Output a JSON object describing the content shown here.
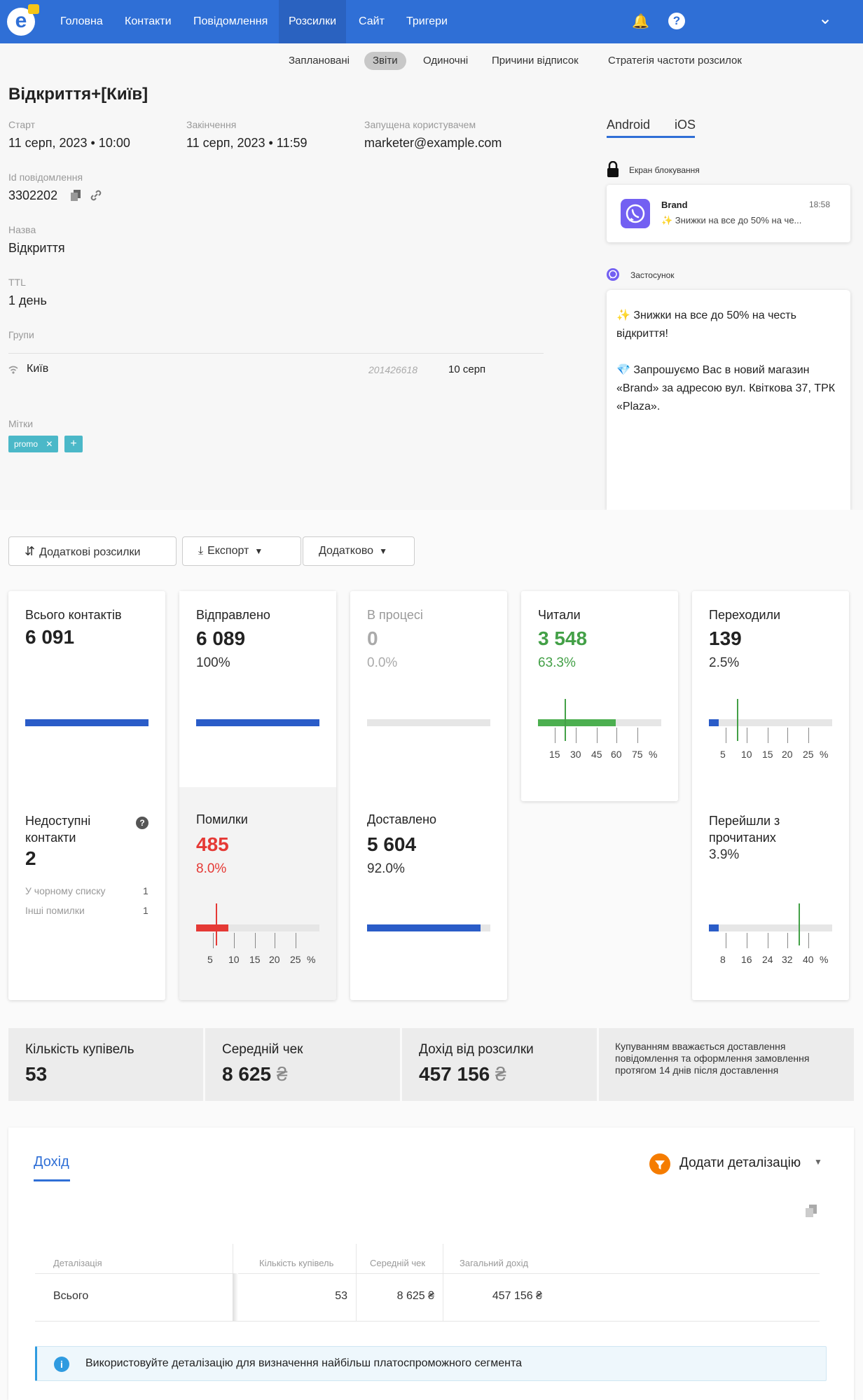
{
  "nav": {
    "logo": "e",
    "items": [
      "Головна",
      "Контакти",
      "Повідомлення",
      "Розсилки",
      "Сайт",
      "Тригери"
    ],
    "bell": "🔔",
    "help": "?",
    "chevron": "⌄",
    "accent": "#2f6fd6"
  },
  "subtabs": [
    "Заплановані",
    "Звіти",
    "Одиночні",
    "Причини відписок",
    "Стратегія частоти розсилок"
  ],
  "header": {
    "title": "Відкриття+[Київ]",
    "start_label": "Старт",
    "start_value": "11 серп, 2023 • 10:00",
    "end_label": "Закінчення",
    "end_value": "11 серп, 2023 • 11:59",
    "user_label": "Запущена користувачем",
    "user_value": "marketer@example.com",
    "id_label": "Id повідомлення",
    "id_value": "3302202",
    "name_label": "Назва",
    "name_value": "Відкриття",
    "ttl_label": "TTL",
    "ttl_value": "1 день",
    "groups_label": "Групи",
    "group_name": "Київ",
    "group_id": "201426618",
    "group_date": "10 серп",
    "tags_label": "Мітки",
    "tag": "promo",
    "tag_remove": "✕",
    "tag_add": "+"
  },
  "preview": {
    "tab_android": "Android",
    "tab_ios": "iOS",
    "lock_label": "Екран блокування",
    "notif_brand": "Brand",
    "notif_time": "18:58",
    "notif_text": "✨ Знижки на все до 50% на че...",
    "app_label": "Застосунок",
    "msg_p1": "✨ Знижки на все до 50% на честь відкриття!",
    "msg_p2": "💎 Запрошуємо Вас в новий магазин «Brand» за адресою вул. Квіткова 37, ТРК «Plaza»."
  },
  "actions": {
    "extra": "Додаткові розсилки",
    "export": "Експорт",
    "more": "Додатково"
  },
  "stats": {
    "total": {
      "label": "Всього контактів",
      "value": "6 091",
      "fill": 1.0
    },
    "sent": {
      "label": "Відправлено",
      "value": "6 089",
      "pct": "100%",
      "fill": 1.0
    },
    "progress": {
      "label": "В процесі",
      "value": "0",
      "pct": "0.0%",
      "fill": 0
    },
    "read": {
      "label": "Читали",
      "value": "3 548",
      "pct": "63.3%",
      "fill": 0.633,
      "ticks": [
        "15",
        "30",
        "45",
        "60",
        "75",
        "%"
      ],
      "color": "#4caf50"
    },
    "clicked": {
      "label": "Переходили",
      "value": "139",
      "pct": "2.5%",
      "fill": 0.025,
      "ticks": [
        "5",
        "10",
        "15",
        "20",
        "25",
        "%"
      ]
    },
    "unavailable": {
      "label": "Недоступні контакти",
      "value": "2",
      "help": "?",
      "rows": [
        {
          "k": "У чорному списку",
          "v": "1"
        },
        {
          "k": "Інші помилки",
          "v": "1"
        }
      ]
    },
    "errors": {
      "label": "Помилки",
      "value": "485",
      "pct": "8.0%",
      "fill": 0.08,
      "ticks": [
        "5",
        "10",
        "15",
        "20",
        "25",
        "%"
      ],
      "color": "#e53935"
    },
    "delivered": {
      "label": "Доставлено",
      "value": "5 604",
      "pct": "92.0%",
      "fill": 0.92
    },
    "read_clicks": {
      "label": "Перейшли з прочитаних",
      "pct": "3.9%",
      "fill": 0.039,
      "ticks": [
        "8",
        "16",
        "24",
        "32",
        "40",
        "%"
      ]
    }
  },
  "revenue": {
    "purchases_label": "Кількість купівель",
    "purchases_value": "53",
    "avg_label": "Середній чек",
    "avg_value": "8 625",
    "income_label": "Дохід від розсилки",
    "income_value": "457 156",
    "currency": "₴",
    "note": "Купуванням вважається доставлення повідомлення та оформлення замовлення протягом 14 днів після доставлення"
  },
  "income": {
    "tab": "Дохід",
    "add_detail": "Додати деталізацію",
    "columns": [
      "Деталізація",
      "Кількість купівель",
      "Середній чек",
      "Загальний дохід"
    ],
    "row": {
      "name": "Всього",
      "purchases": "53",
      "avg": "8 625 ₴",
      "total": "457 156 ₴"
    },
    "hint": "Використовуйте деталізацію для визначення найбільш платоспроможного сегмента"
  }
}
